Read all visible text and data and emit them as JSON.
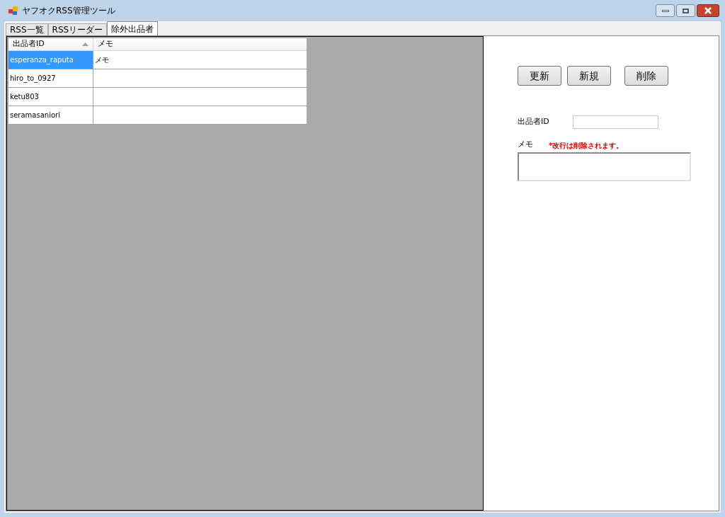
{
  "window": {
    "title": "ヤフオクRSS管理ツール"
  },
  "tabs": [
    {
      "label": "RSS一覧",
      "selected": false
    },
    {
      "label": "RSSリーダー",
      "selected": false
    },
    {
      "label": "除外出品者",
      "selected": true
    }
  ],
  "table": {
    "columns": [
      {
        "label": "出品者ID",
        "sorted": true
      },
      {
        "label": "メモ",
        "sorted": false
      }
    ],
    "rows": [
      {
        "seller_id": "esperanza_raputa",
        "memo": "メモ",
        "selected": true
      },
      {
        "seller_id": "hiro_to_0927",
        "selected": false
      },
      {
        "seller_id": "ketu803",
        "selected": false
      },
      {
        "seller_id": "seramasaniori",
        "selected": false
      }
    ]
  },
  "buttons": [
    "更新",
    "新規",
    "削除"
  ],
  "form": {
    "id_label": "出品者ID",
    "memo_label": "メモ",
    "memo_note": "*改行は削除されます。"
  }
}
